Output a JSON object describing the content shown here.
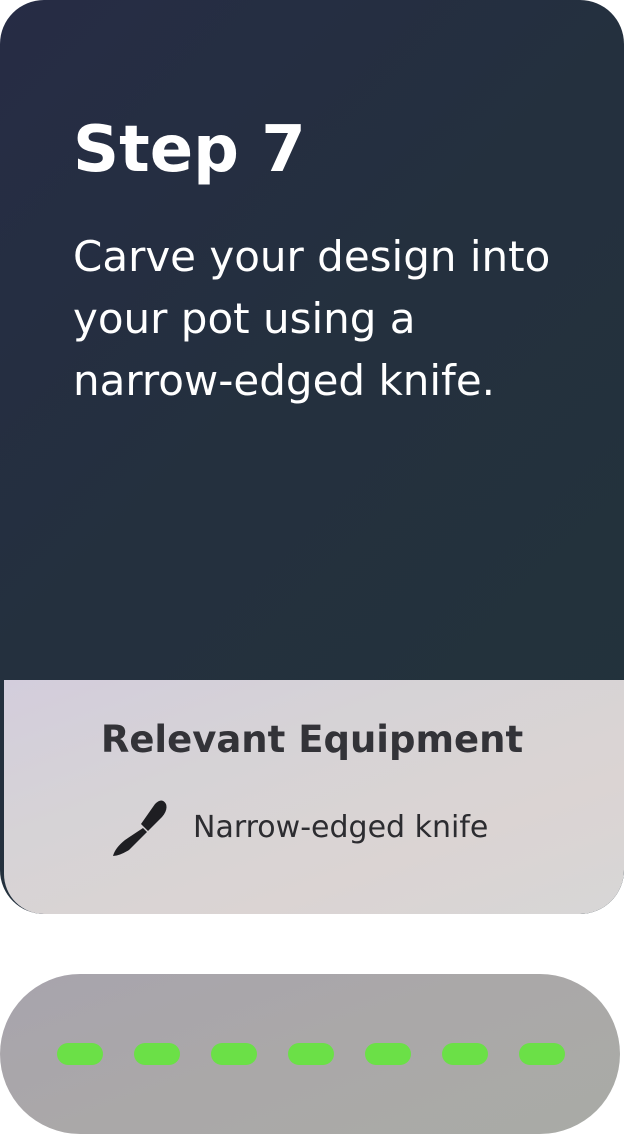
{
  "step": {
    "title": "Step 7",
    "instruction": "Carve your design into your pot using a narrow-edged knife."
  },
  "equipment": {
    "heading": "Relevant Equipment",
    "items": [
      {
        "icon": "knife-icon",
        "label": "Narrow-edged knife"
      }
    ]
  },
  "progress": {
    "total_steps": 7,
    "completed_steps": 7,
    "dot_color": "#6be047"
  },
  "colors": {
    "card_background": "#24303e",
    "panel_background": "#d6d3d6",
    "pill_background": "#aaa8a8"
  }
}
